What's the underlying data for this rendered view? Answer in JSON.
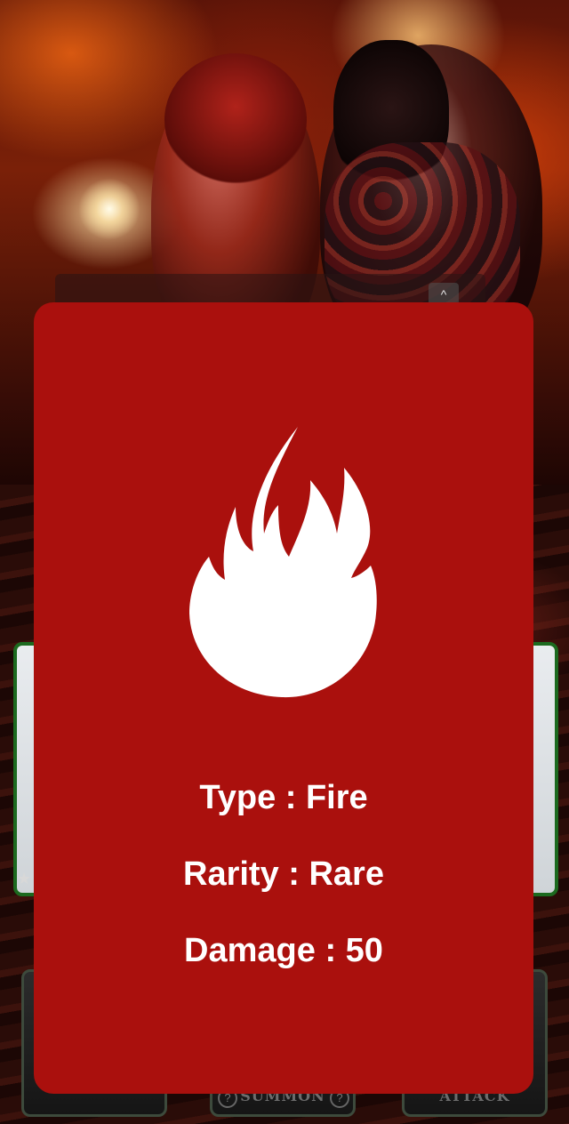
{
  "background": {
    "info_strip_text": "",
    "collapse_chevron": "^",
    "menu": [
      {
        "label": ""
      },
      {
        "label": "SUMMON"
      },
      {
        "label": "ATTACK"
      }
    ],
    "help_glyph": "?"
  },
  "card_modal": {
    "icon": "fire-icon",
    "background_color": "#aa100d",
    "icon_color": "#ffffff",
    "type_text": "Type : Fire",
    "rarity_text": "Rarity : Rare",
    "damage_text": "Damage : 50"
  }
}
